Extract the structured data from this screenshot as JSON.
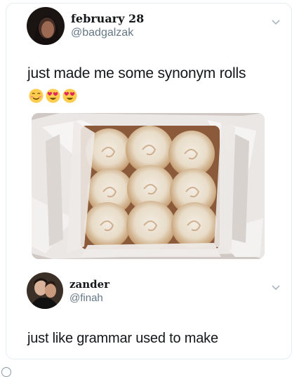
{
  "tweet": {
    "name": "february 28",
    "handle": "@badgalzak",
    "text": "just made me some synonym rolls",
    "emojis": [
      "relieved-face",
      "heart-eyes-face",
      "heart-eyes-face"
    ]
  },
  "reply": {
    "name": "zander",
    "handle": "@finah",
    "text": "just like grammar used to make"
  },
  "colors": {
    "text": "#14171a",
    "secondary": "#657786",
    "border": "#e6ecf0",
    "emoji_yellow": "#ffcc4d",
    "heart_red": "#e0245e"
  }
}
